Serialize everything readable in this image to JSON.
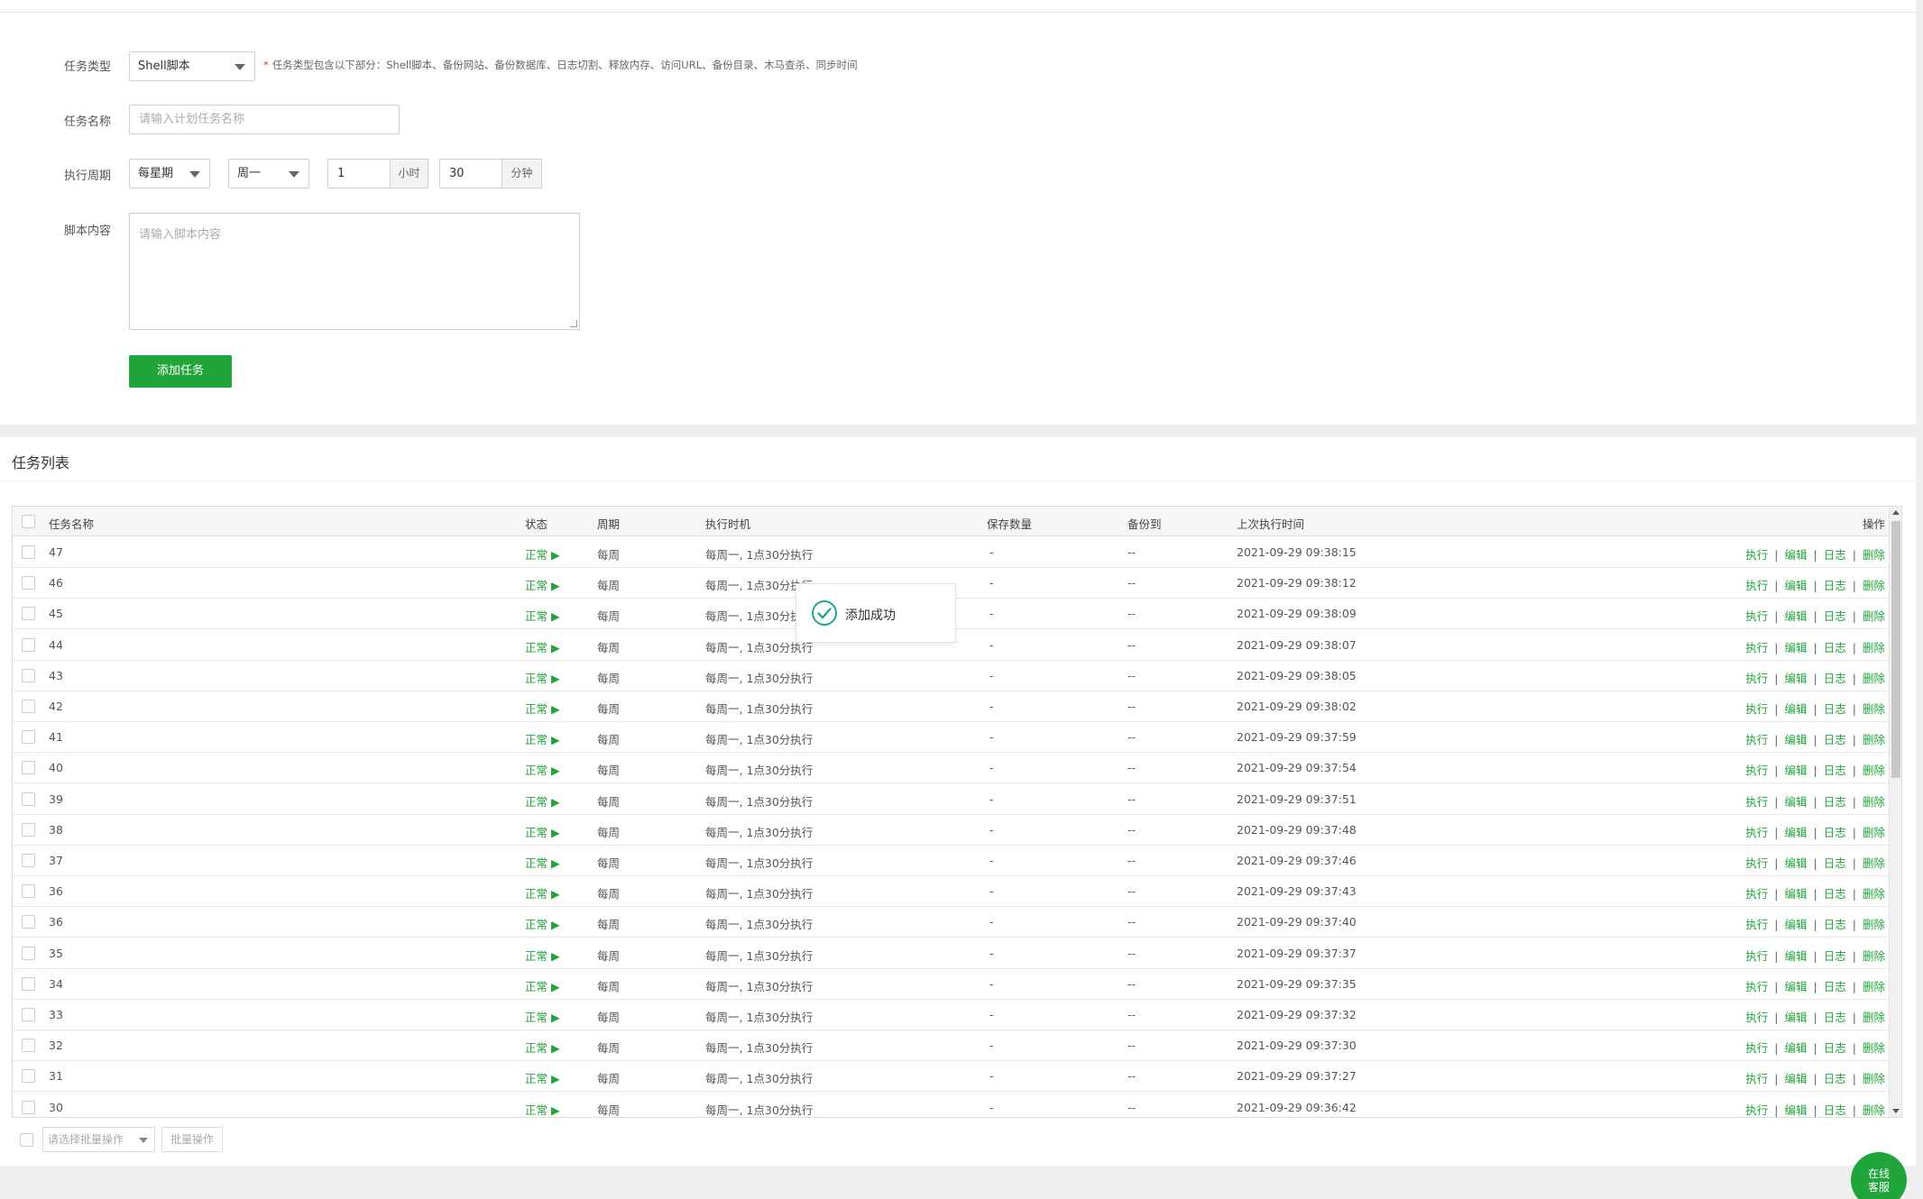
{
  "form": {
    "task_type_label": "任务类型",
    "task_type_value": "Shell脚本",
    "task_type_hint": "任务类型包含以下部分：Shell脚本、备份网站、备份数据库、日志切割、释放内存、访问URL、备份目录、木马查杀、同步时间",
    "task_name_label": "任务名称",
    "task_name_placeholder": "请输入计划任务名称",
    "period_label": "执行周期",
    "period_value": "每星期",
    "weekday_value": "周一",
    "hour_value": "1",
    "hour_unit": "小时",
    "minute_value": "30",
    "minute_unit": "分钟",
    "script_label": "脚本内容",
    "script_placeholder": "请输入脚本内容",
    "add_button": "添加任务"
  },
  "list": {
    "title": "任务列表",
    "columns": {
      "name": "任务名称",
      "status": "状态",
      "period": "周期",
      "exec_time": "执行时机",
      "keep_count": "保存数量",
      "backup_to": "备份到",
      "last_run": "上次执行时间",
      "ops": "操作"
    },
    "ops_labels": {
      "run": "执行",
      "edit": "编辑",
      "log": "日志",
      "delete": "删除"
    },
    "rows": [
      {
        "name": "47",
        "status": "正常",
        "period": "每周",
        "exec_time": "每周一, 1点30分执行",
        "keep_count": "-",
        "backup_to": "--",
        "last_run": "2021-09-29 09:38:15"
      },
      {
        "name": "46",
        "status": "正常",
        "period": "每周",
        "exec_time": "每周一, 1点30分执行",
        "keep_count": "-",
        "backup_to": "--",
        "last_run": "2021-09-29 09:38:12"
      },
      {
        "name": "45",
        "status": "正常",
        "period": "每周",
        "exec_time": "每周一, 1点30分执行",
        "keep_count": "-",
        "backup_to": "--",
        "last_run": "2021-09-29 09:38:09"
      },
      {
        "name": "44",
        "status": "正常",
        "period": "每周",
        "exec_time": "每周一, 1点30分执行",
        "keep_count": "-",
        "backup_to": "--",
        "last_run": "2021-09-29 09:38:07"
      },
      {
        "name": "43",
        "status": "正常",
        "period": "每周",
        "exec_time": "每周一, 1点30分执行",
        "keep_count": "-",
        "backup_to": "--",
        "last_run": "2021-09-29 09:38:05"
      },
      {
        "name": "42",
        "status": "正常",
        "period": "每周",
        "exec_time": "每周一, 1点30分执行",
        "keep_count": "-",
        "backup_to": "--",
        "last_run": "2021-09-29 09:38:02"
      },
      {
        "name": "41",
        "status": "正常",
        "period": "每周",
        "exec_time": "每周一, 1点30分执行",
        "keep_count": "-",
        "backup_to": "--",
        "last_run": "2021-09-29 09:37:59"
      },
      {
        "name": "40",
        "status": "正常",
        "period": "每周",
        "exec_time": "每周一, 1点30分执行",
        "keep_count": "-",
        "backup_to": "--",
        "last_run": "2021-09-29 09:37:54"
      },
      {
        "name": "39",
        "status": "正常",
        "period": "每周",
        "exec_time": "每周一, 1点30分执行",
        "keep_count": "-",
        "backup_to": "--",
        "last_run": "2021-09-29 09:37:51"
      },
      {
        "name": "38",
        "status": "正常",
        "period": "每周",
        "exec_time": "每周一, 1点30分执行",
        "keep_count": "-",
        "backup_to": "--",
        "last_run": "2021-09-29 09:37:48"
      },
      {
        "name": "37",
        "status": "正常",
        "period": "每周",
        "exec_time": "每周一, 1点30分执行",
        "keep_count": "-",
        "backup_to": "--",
        "last_run": "2021-09-29 09:37:46"
      },
      {
        "name": "36",
        "status": "正常",
        "period": "每周",
        "exec_time": "每周一, 1点30分执行",
        "keep_count": "-",
        "backup_to": "--",
        "last_run": "2021-09-29 09:37:43"
      },
      {
        "name": "36",
        "status": "正常",
        "period": "每周",
        "exec_time": "每周一, 1点30分执行",
        "keep_count": "-",
        "backup_to": "--",
        "last_run": "2021-09-29 09:37:40"
      },
      {
        "name": "35",
        "status": "正常",
        "period": "每周",
        "exec_time": "每周一, 1点30分执行",
        "keep_count": "-",
        "backup_to": "--",
        "last_run": "2021-09-29 09:37:37"
      },
      {
        "name": "34",
        "status": "正常",
        "period": "每周",
        "exec_time": "每周一, 1点30分执行",
        "keep_count": "-",
        "backup_to": "--",
        "last_run": "2021-09-29 09:37:35"
      },
      {
        "name": "33",
        "status": "正常",
        "period": "每周",
        "exec_time": "每周一, 1点30分执行",
        "keep_count": "-",
        "backup_to": "--",
        "last_run": "2021-09-29 09:37:32"
      },
      {
        "name": "32",
        "status": "正常",
        "period": "每周",
        "exec_time": "每周一, 1点30分执行",
        "keep_count": "-",
        "backup_to": "--",
        "last_run": "2021-09-29 09:37:30"
      },
      {
        "name": "31",
        "status": "正常",
        "period": "每周",
        "exec_time": "每周一, 1点30分执行",
        "keep_count": "-",
        "backup_to": "--",
        "last_run": "2021-09-29 09:37:27"
      },
      {
        "name": "30",
        "status": "正常",
        "period": "每周",
        "exec_time": "每周一, 1点30分执行",
        "keep_count": "-",
        "backup_to": "--",
        "last_run": "2021-09-29 09:36:42"
      }
    ],
    "batch_select_placeholder": "请选择批量操作",
    "batch_button": "批量操作"
  },
  "toast": {
    "text": "添加成功",
    "icon": "check-circle-icon"
  },
  "service_button": {
    "line1": "在线",
    "line2": "客服"
  },
  "colors": {
    "accent": "#20a53a",
    "required": "#e3352b"
  }
}
